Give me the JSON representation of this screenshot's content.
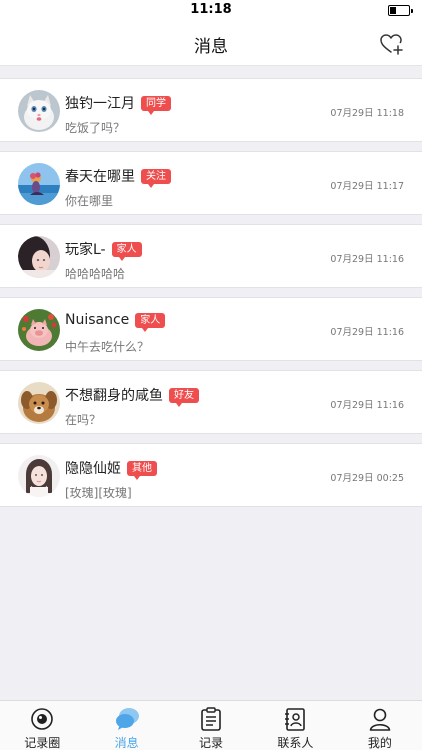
{
  "status_bar": {
    "time": "11:18"
  },
  "header": {
    "title": "消息",
    "heart_icon": "heart-plus-icon"
  },
  "colors": {
    "tag": "#ee4e4e",
    "active_tab": "#4ea5e8"
  },
  "conversations": [
    {
      "name": "独钓一江月",
      "tag": "同学",
      "message": "吃饭了吗？",
      "time": "07月29日 11:18",
      "avatar": "cat-avatar"
    },
    {
      "name": "春天在哪里",
      "tag": "关注",
      "message": "你在哪里",
      "time": "07月29日 11:17",
      "avatar": "seaside-avatar"
    },
    {
      "name": "玩家L-",
      "tag": "家人",
      "message": "哈哈哈哈哈",
      "time": "07月29日 11:16",
      "avatar": "girl-avatar"
    },
    {
      "name": "Nuisance",
      "tag": "家人",
      "message": "中午去吃什么？",
      "time": "07月29日 11:16",
      "avatar": "pig-avatar"
    },
    {
      "name": "不想翻身的咸鱼",
      "tag": "好友",
      "message": "在吗？",
      "time": "07月29日 11:16",
      "avatar": "dog-avatar"
    },
    {
      "name": "隐隐仙姬",
      "tag": "其他",
      "message": "[玫瑰][玫瑰]",
      "time": "07月29日 00:25",
      "avatar": "lady-avatar"
    }
  ],
  "tabs": [
    {
      "label": "记录圈",
      "icon": "record-circle-icon",
      "active": false
    },
    {
      "label": "消息",
      "icon": "chat-bubble-icon",
      "active": true
    },
    {
      "label": "记录",
      "icon": "clipboard-icon",
      "active": false
    },
    {
      "label": "联系人",
      "icon": "contact-book-icon",
      "active": false
    },
    {
      "label": "我的",
      "icon": "user-icon",
      "active": false
    }
  ]
}
